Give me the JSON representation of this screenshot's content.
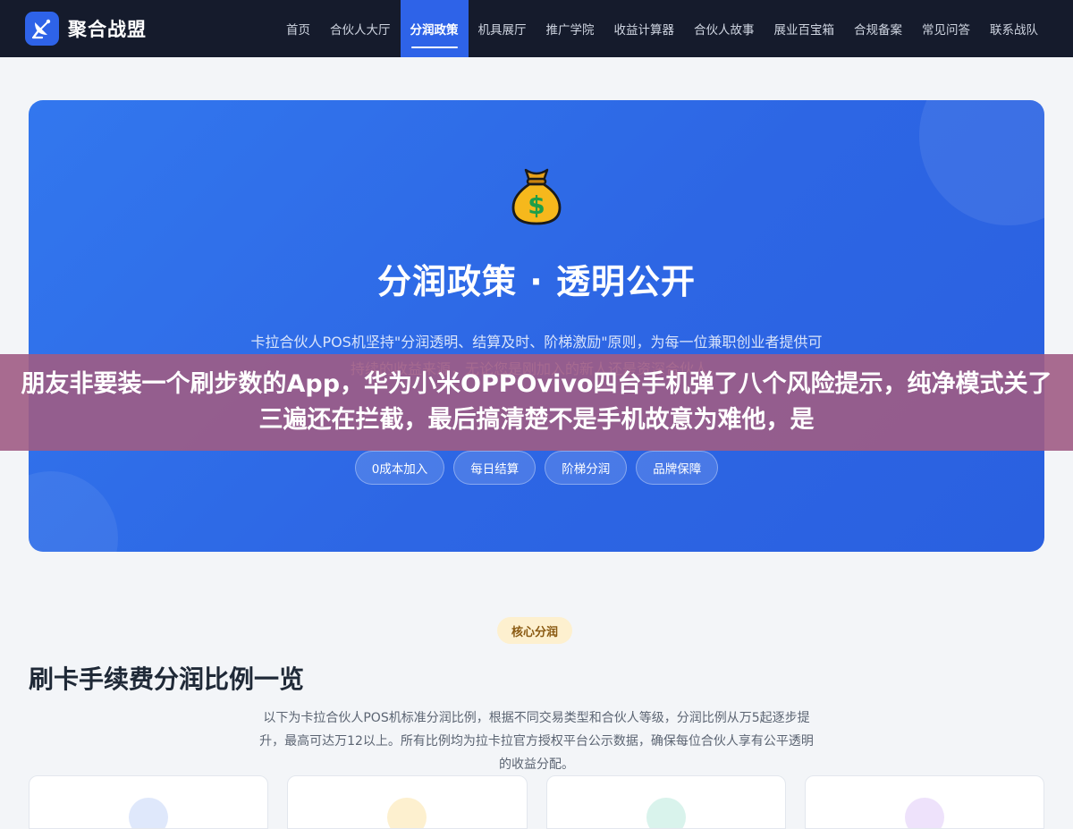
{
  "brand": {
    "name": "聚合战盟",
    "logo_icon": "satellite-dish-icon",
    "accent": "#2e63e8"
  },
  "nav": {
    "items": [
      {
        "label": "首页",
        "active": false
      },
      {
        "label": "合伙人大厅",
        "active": false
      },
      {
        "label": "分润政策",
        "active": true
      },
      {
        "label": "机具展厅",
        "active": false
      },
      {
        "label": "推广学院",
        "active": false
      },
      {
        "label": "收益计算器",
        "active": false
      },
      {
        "label": "合伙人故事",
        "active": false
      },
      {
        "label": "展业百宝箱",
        "active": false
      },
      {
        "label": "合规备案",
        "active": false
      },
      {
        "label": "常见问答",
        "active": false
      },
      {
        "label": "联系战队",
        "active": false
      }
    ]
  },
  "hero": {
    "icon": "money-bag-icon",
    "title": "分润政策 · 透明公开",
    "desc": "卡拉合伙人POS机坚持\"分润透明、结算及时、阶梯激励\"原则，为每一位兼职创业者提供可持续的收益来源，无论您是刚加入的新人还是资深合伙人。",
    "tags": [
      "0成本加入",
      "每日结算",
      "阶梯分润",
      "品牌保障"
    ]
  },
  "overlay": {
    "text": "朋友非要装一个刷步数的App，华为小米OPPOvivo四台手机弹了八个风险提示，纯净模式关了三遍还在拦截，最后搞清楚不是手机故意为难他，是"
  },
  "section": {
    "badge": "核心分润",
    "title": "刷卡手续费分润比例一览",
    "desc": "以下为卡拉合伙人POS机标准分润比例，根据不同交易类型和合伙人等级，分润比例从万5起逐步提升，最高可达万12以上。所有比例均为拉卡拉官方授权平台公示数据，确保每位合伙人享有公平透明的收益分配。"
  },
  "cards": [
    {
      "color": "#dfe8fb"
    },
    {
      "color": "#fdf0cf"
    },
    {
      "color": "#d9f3ec"
    },
    {
      "color": "#eee2fb"
    }
  ]
}
